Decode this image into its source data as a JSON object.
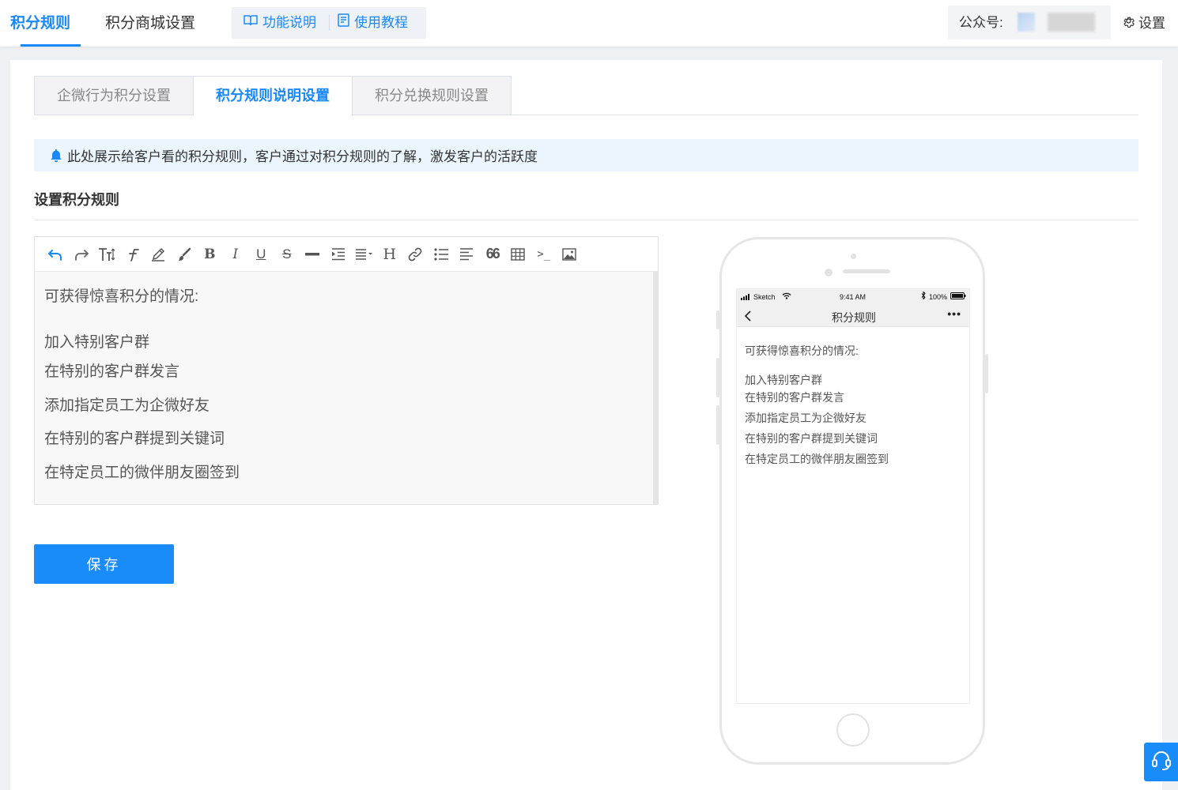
{
  "header": {
    "tabs": [
      {
        "label": "积分规则",
        "active": true
      },
      {
        "label": "积分商城设置",
        "active": false
      }
    ],
    "help": {
      "feature_label": "功能说明",
      "tutorial_label": "使用教程"
    },
    "account_label": "公众号:",
    "settings_label": "设置"
  },
  "subtabs": [
    {
      "label": "企微行为积分设置",
      "active": false
    },
    {
      "label": "积分规则说明设置",
      "active": true
    },
    {
      "label": "积分兑换规则设置",
      "active": false
    }
  ],
  "notice": "此处展示给客户看的积分规则，客户通过对积分规则的了解，激发客户的活跃度",
  "section_title": "设置积分规则",
  "toolbar": {
    "icons": [
      "undo-icon",
      "redo-icon",
      "font-size-icon",
      "font-family-icon",
      "highlight-icon",
      "brush-icon",
      "bold-icon",
      "italic-icon",
      "underline-icon",
      "strikethrough-icon",
      "divider-icon",
      "indent-icon",
      "align-icon",
      "heading-icon",
      "link-icon",
      "list-icon",
      "justify-icon",
      "quote-icon",
      "table-icon",
      "code-icon",
      "image-icon"
    ],
    "glyphs": {
      "bold": "B",
      "italic": "I",
      "underline": "U",
      "strike": "S",
      "heading": "H",
      "quote": "66",
      "code": ">_"
    }
  },
  "editor": {
    "lines": [
      "可获得惊喜积分的情况:",
      "加入特别客户群",
      "在特别的客户群发言",
      "添加指定员工为企微好友",
      "在特别的客户群提到关键词",
      "在特定员工的微伴朋友圈签到"
    ]
  },
  "save_label": "保存",
  "phone": {
    "carrier": "Sketch",
    "time": "9:41 AM",
    "battery": "100%",
    "title": "积分规则",
    "more": "•••",
    "lines": [
      "可获得惊喜积分的情况:",
      "加入特别客户群",
      "在特别的客户群发言",
      "添加指定员工为企微好友",
      "在特别的客户群提到关键词",
      "在特定员工的微伴朋友圈签到"
    ]
  },
  "colors": {
    "accent": "#1989fa",
    "notice_bg": "#eaf5fd",
    "save_bg": "#1a8cfa"
  }
}
